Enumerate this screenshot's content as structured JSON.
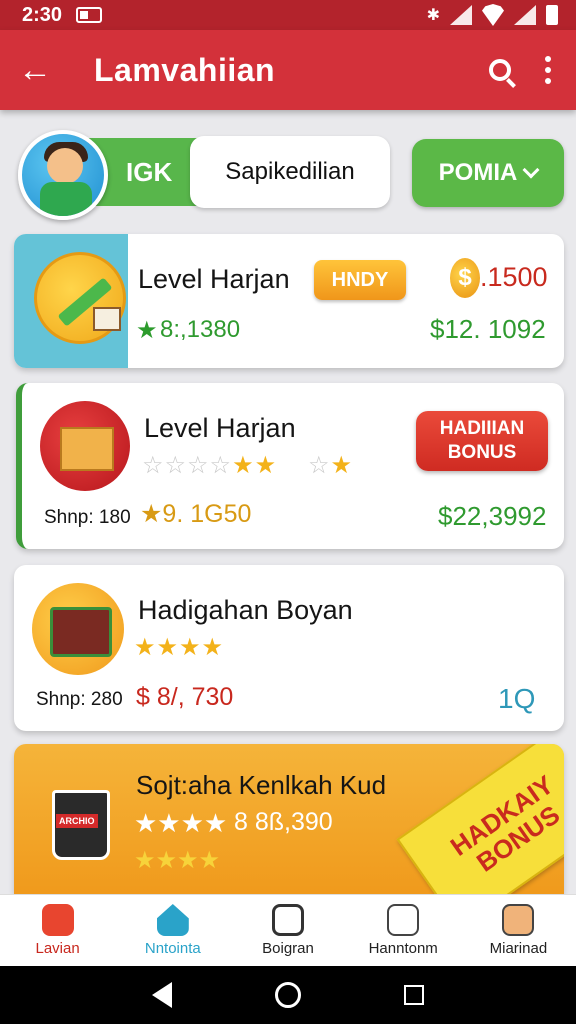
{
  "status_bar": {
    "time": "2:30"
  },
  "app_bar": {
    "title": "Lamvahiian"
  },
  "header": {
    "toggle_left": "IGK",
    "toggle_right": "Sapikedilian",
    "dropdown_label": "POMIA"
  },
  "cards": [
    {
      "title": "Level Harjan",
      "tag": "HNDY",
      "coin_symbol": "$",
      "price": ".1500",
      "stat_value": "8:,1380",
      "amount": "$12. 1092"
    },
    {
      "title": "Level Harjan",
      "button_line1": "HADIIIAN",
      "button_line2": "BONUS",
      "shnp": "Shnp: 180",
      "stat_value": "9. 1G50",
      "amount": "$22,3992"
    },
    {
      "title": "Hadigahan Boyan",
      "shnp": "Shnp: 280",
      "stat_value": "$ 8/, 730",
      "amount": "1Q"
    },
    {
      "title": "Sojt:aha Kenlkah Kud",
      "stat_value": "8 8ß,390",
      "ribbon_line1": "HADKAIY",
      "ribbon_line2": "BONUS"
    }
  ],
  "bottom_nav": [
    {
      "label": "Lavian",
      "icon": "game-icon",
      "color": "#e8452f"
    },
    {
      "label": "Nntointa",
      "icon": "house-icon",
      "color": "#2aa3c9"
    },
    {
      "label": "Boigran",
      "icon": "document-icon",
      "color": "#333333"
    },
    {
      "label": "Hanntonm",
      "icon": "bear-icon",
      "color": "#444444"
    },
    {
      "label": "Miarinad",
      "icon": "person-icon",
      "color": "#444444"
    }
  ],
  "colors": {
    "app_bar": "#d3313a",
    "status_bar": "#b3232c",
    "accent_green": "#5bb847",
    "price_red": "#c8281e",
    "price_green": "#2f9a2f"
  }
}
